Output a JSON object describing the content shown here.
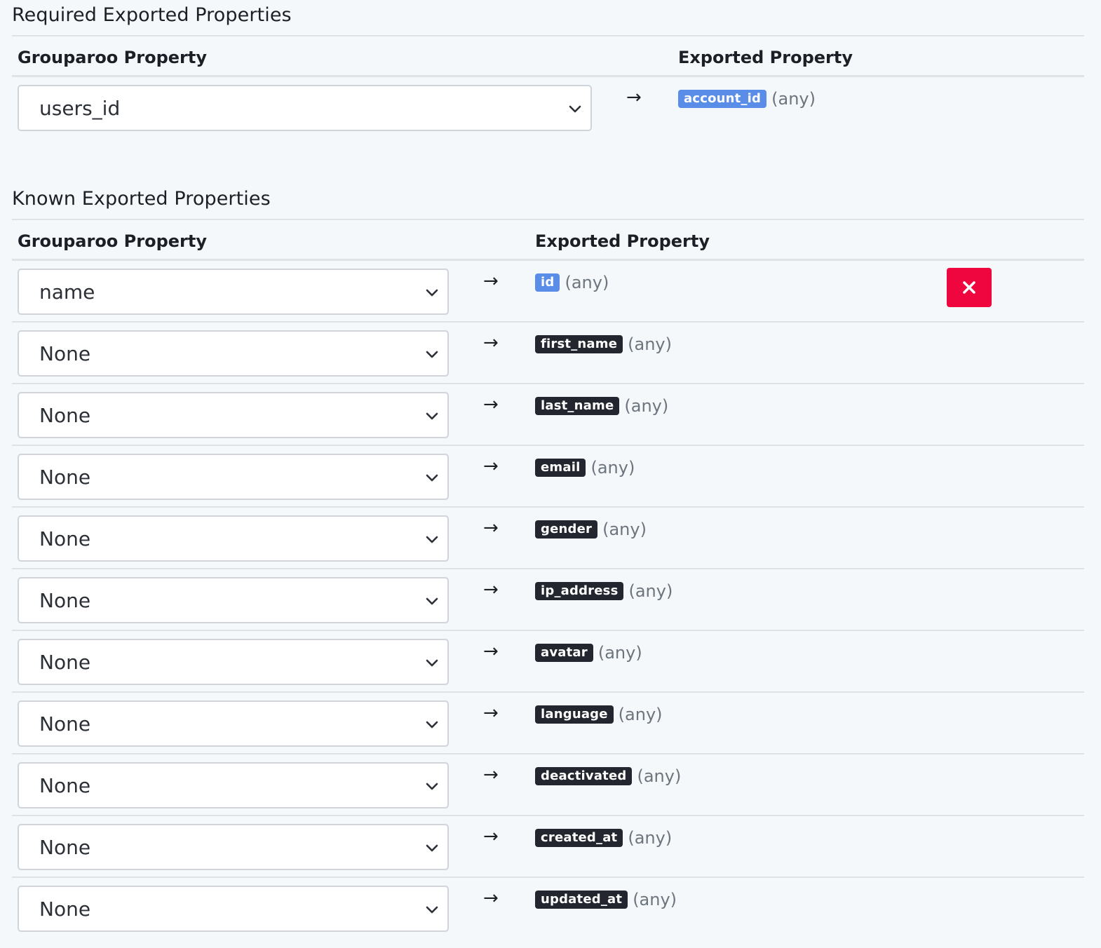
{
  "required_section": {
    "title": "Required Exported Properties",
    "col_grouparoo": "Grouparoo Property",
    "col_exported": "Exported Property",
    "rows": [
      {
        "selected": "users_id",
        "arrow": "→",
        "property": "account_id",
        "type": "(any)",
        "badge_style": "primary"
      }
    ]
  },
  "known_section": {
    "title": "Known Exported Properties",
    "col_grouparoo": "Grouparoo Property",
    "col_exported": "Exported Property",
    "remove_icon": "close-icon",
    "rows": [
      {
        "selected": "name",
        "arrow": "→",
        "property": "id",
        "type": "(any)",
        "badge_style": "primary"
      },
      {
        "selected": "None",
        "arrow": "→",
        "property": "first_name",
        "type": "(any)",
        "badge_style": "dark"
      },
      {
        "selected": "None",
        "arrow": "→",
        "property": "last_name",
        "type": "(any)",
        "badge_style": "dark"
      },
      {
        "selected": "None",
        "arrow": "→",
        "property": "email",
        "type": "(any)",
        "badge_style": "dark"
      },
      {
        "selected": "None",
        "arrow": "→",
        "property": "gender",
        "type": "(any)",
        "badge_style": "dark"
      },
      {
        "selected": "None",
        "arrow": "→",
        "property": "ip_address",
        "type": "(any)",
        "badge_style": "dark"
      },
      {
        "selected": "None",
        "arrow": "→",
        "property": "avatar",
        "type": "(any)",
        "badge_style": "dark"
      },
      {
        "selected": "None",
        "arrow": "→",
        "property": "language",
        "type": "(any)",
        "badge_style": "dark"
      },
      {
        "selected": "None",
        "arrow": "→",
        "property": "deactivated",
        "type": "(any)",
        "badge_style": "dark"
      },
      {
        "selected": "None",
        "arrow": "→",
        "property": "created_at",
        "type": "(any)",
        "badge_style": "dark"
      },
      {
        "selected": "None",
        "arrow": "→",
        "property": "updated_at",
        "type": "(any)",
        "badge_style": "dark"
      }
    ]
  },
  "colors": {
    "background": "#f5f8fa",
    "badge_primary": "#5a8de7",
    "badge_dark": "#23262f",
    "danger": "#f0063e"
  }
}
